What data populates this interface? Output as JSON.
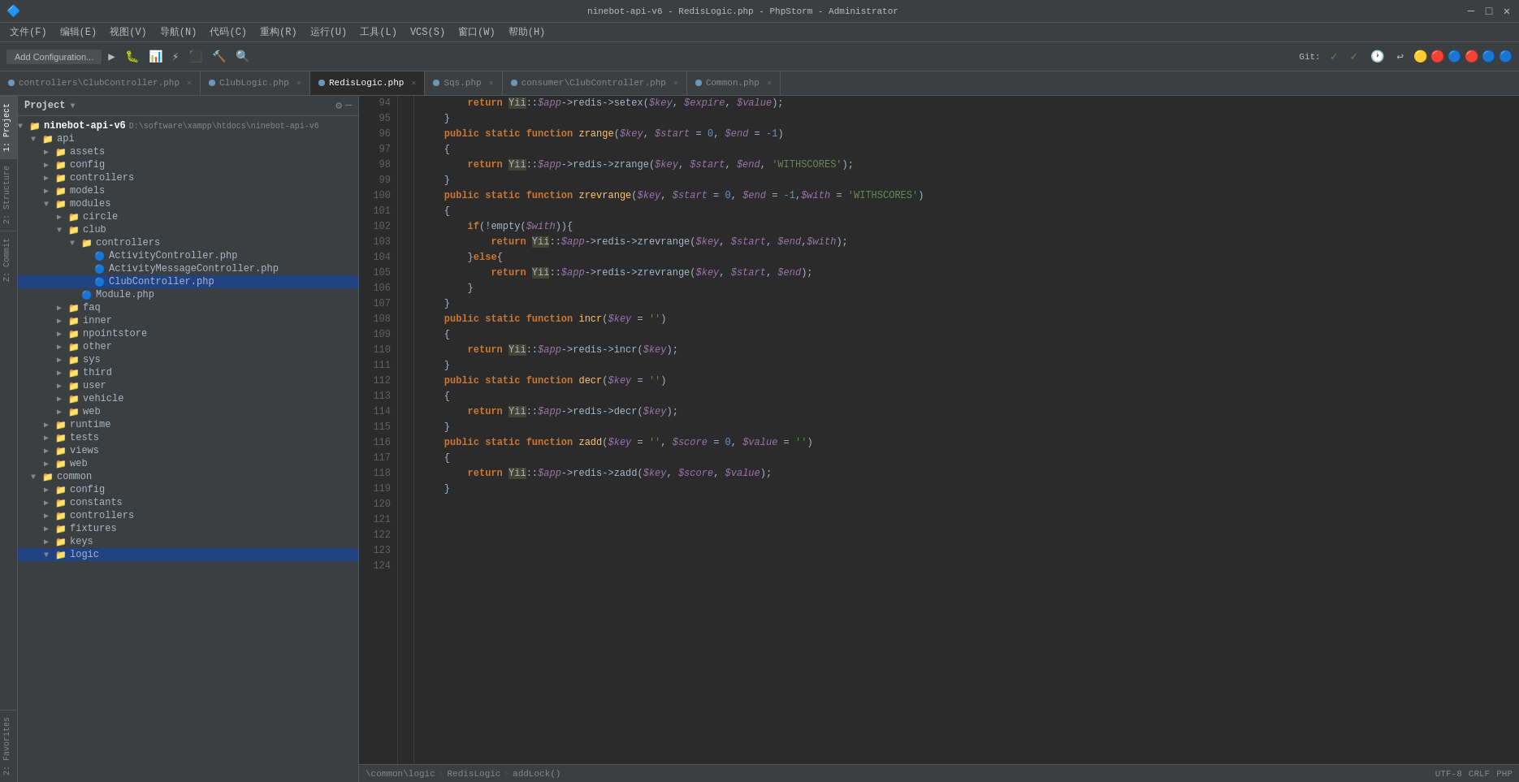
{
  "app": {
    "title": "ninebot-api-v6 - RedisLogic.php - PhpStorm - Administrator"
  },
  "menubar": {
    "items": [
      "文件(F)",
      "编辑(E)",
      "视图(V)",
      "导航(N)",
      "代码(C)",
      "重构(R)",
      "运行(U)",
      "工具(L)",
      "VCS(S)",
      "窗口(W)",
      "帮助(H)"
    ]
  },
  "toolbar": {
    "add_config": "Add Configuration...",
    "git_label": "Git:"
  },
  "tabs": [
    {
      "label": "controllers\\ClubController.php",
      "color": "#6897bb",
      "active": false
    },
    {
      "label": "ClubLogic.php",
      "color": "#6897bb",
      "active": false
    },
    {
      "label": "RedisLogic.php",
      "color": "#6897bb",
      "active": true
    },
    {
      "label": "Sqs.php",
      "color": "#6897bb",
      "active": false
    },
    {
      "label": "consumer\\ClubController.php",
      "color": "#6897bb",
      "active": false
    },
    {
      "label": "Common.php",
      "color": "#6897bb",
      "active": false
    }
  ],
  "project": {
    "title": "Project",
    "root": {
      "label": "ninebot-api-v6",
      "path": "D:\\software\\xampp\\htdocs\\ninebot-api-v6",
      "children": [
        {
          "label": "api",
          "type": "folder",
          "indent": 1,
          "expanded": true
        },
        {
          "label": "assets",
          "type": "folder",
          "indent": 2
        },
        {
          "label": "config",
          "type": "folder",
          "indent": 2
        },
        {
          "label": "controllers",
          "type": "folder",
          "indent": 2
        },
        {
          "label": "models",
          "type": "folder",
          "indent": 2
        },
        {
          "label": "modules",
          "type": "folder",
          "indent": 2,
          "expanded": true
        },
        {
          "label": "circle",
          "type": "folder",
          "indent": 3
        },
        {
          "label": "club",
          "type": "folder",
          "indent": 3,
          "expanded": true
        },
        {
          "label": "controllers",
          "type": "folder",
          "indent": 4,
          "expanded": true
        },
        {
          "label": "ActivityController.php",
          "type": "file",
          "indent": 5
        },
        {
          "label": "ActivityMessageController.php",
          "type": "file",
          "indent": 5
        },
        {
          "label": "ClubController.php",
          "type": "file",
          "indent": 5,
          "selected": true
        },
        {
          "label": "Module.php",
          "type": "file",
          "indent": 4
        },
        {
          "label": "faq",
          "type": "folder",
          "indent": 3
        },
        {
          "label": "inner",
          "type": "folder",
          "indent": 3
        },
        {
          "label": "npointstore",
          "type": "folder",
          "indent": 3
        },
        {
          "label": "other",
          "type": "folder",
          "indent": 3
        },
        {
          "label": "sys",
          "type": "folder",
          "indent": 3
        },
        {
          "label": "third",
          "type": "folder",
          "indent": 3
        },
        {
          "label": "user",
          "type": "folder",
          "indent": 3
        },
        {
          "label": "vehicle",
          "type": "folder",
          "indent": 3
        },
        {
          "label": "web",
          "type": "folder",
          "indent": 3
        },
        {
          "label": "runtime",
          "type": "folder",
          "indent": 2
        },
        {
          "label": "tests",
          "type": "folder",
          "indent": 2
        },
        {
          "label": "views",
          "type": "folder",
          "indent": 2
        },
        {
          "label": "web",
          "type": "folder",
          "indent": 2
        },
        {
          "label": "common",
          "type": "folder",
          "indent": 1,
          "expanded": true
        },
        {
          "label": "config",
          "type": "folder",
          "indent": 2
        },
        {
          "label": "constants",
          "type": "folder",
          "indent": 2
        },
        {
          "label": "controllers",
          "type": "folder",
          "indent": 2
        },
        {
          "label": "fixtures",
          "type": "folder",
          "indent": 2
        },
        {
          "label": "keys",
          "type": "folder",
          "indent": 2
        },
        {
          "label": "logic",
          "type": "folder",
          "indent": 2,
          "selected": true
        }
      ]
    }
  },
  "code": {
    "lines": [
      {
        "num": 94,
        "content": "        return Yii::$app->redis->setex($key, $expire, $value);"
      },
      {
        "num": 95,
        "content": "    }"
      },
      {
        "num": 96,
        "content": ""
      },
      {
        "num": 97,
        "content": "    public static function zrange($key, $start = 0, $end = -1)"
      },
      {
        "num": 98,
        "content": "    {"
      },
      {
        "num": 99,
        "content": "        return Yii::$app->redis->zrange($key, $start, $end, 'WITHSCORES');"
      },
      {
        "num": 100,
        "content": "    }"
      },
      {
        "num": 101,
        "content": ""
      },
      {
        "num": 102,
        "content": "    public static function zrevrange($key, $start = 0, $end = -1,$with = 'WITHSCORES')"
      },
      {
        "num": 103,
        "content": "    {"
      },
      {
        "num": 104,
        "content": "        if(!empty($with)){"
      },
      {
        "num": 105,
        "content": "            return Yii::$app->redis->zrevrange($key, $start, $end,$with);"
      },
      {
        "num": 106,
        "content": "        }else{"
      },
      {
        "num": 107,
        "content": "            return Yii::$app->redis->zrevrange($key, $start, $end);"
      },
      {
        "num": 108,
        "content": "        }"
      },
      {
        "num": 109,
        "content": "    }"
      },
      {
        "num": 110,
        "content": ""
      },
      {
        "num": 111,
        "content": "    public static function incr($key = '')"
      },
      {
        "num": 112,
        "content": "    {"
      },
      {
        "num": 113,
        "content": "        return Yii::$app->redis->incr($key);"
      },
      {
        "num": 114,
        "content": "    }"
      },
      {
        "num": 115,
        "content": ""
      },
      {
        "num": 116,
        "content": "    public static function decr($key = '')"
      },
      {
        "num": 117,
        "content": "    {"
      },
      {
        "num": 118,
        "content": "        return Yii::$app->redis->decr($key);"
      },
      {
        "num": 119,
        "content": "    }"
      },
      {
        "num": 120,
        "content": ""
      },
      {
        "num": 121,
        "content": "    public static function zadd($key = '', $score = 0, $value = '')"
      },
      {
        "num": 122,
        "content": "    {"
      },
      {
        "num": 123,
        "content": "        return Yii::$app->redis->zadd($key, $score, $value);"
      },
      {
        "num": 124,
        "content": "    }"
      }
    ]
  },
  "statusbar": {
    "breadcrumb": [
      "\\common\\logic",
      "RedisLogic",
      "addLock()"
    ],
    "encoding": "UTF-8",
    "line_sep": "CRLF",
    "lang": "PHP"
  },
  "left_sidebar": {
    "tabs": [
      "1: Project",
      "2: Structure",
      "Z: Commit",
      "2: Favorites"
    ]
  }
}
